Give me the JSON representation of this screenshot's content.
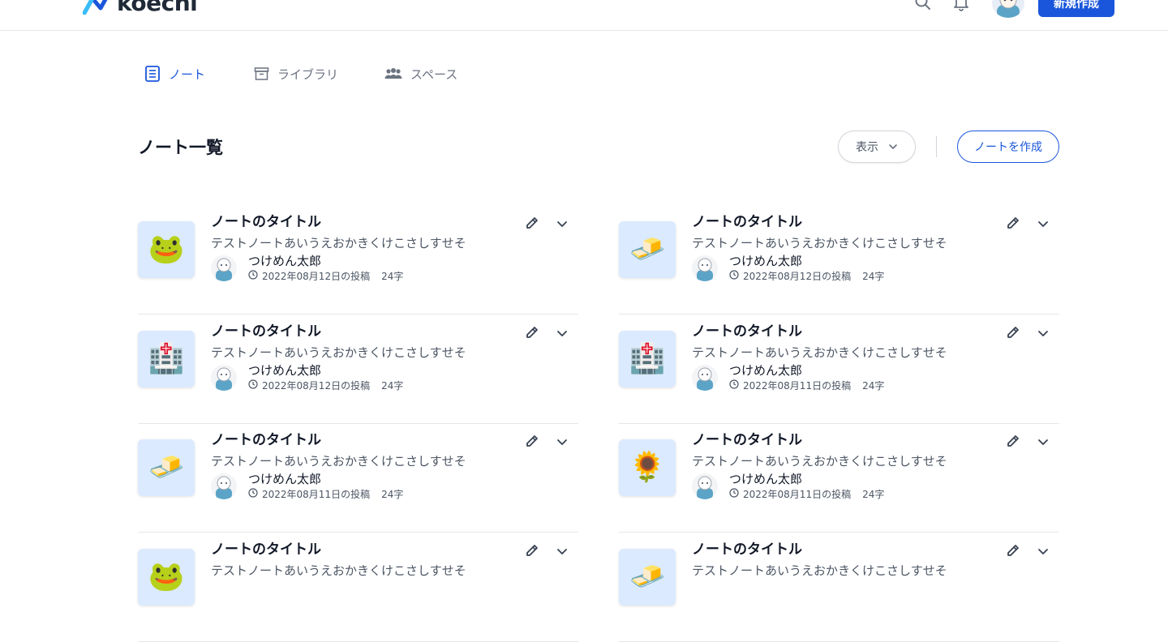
{
  "header": {
    "logo_text": "koechi",
    "new_button": "新規作成",
    "icons": [
      "search-icon",
      "bell-icon",
      "avatar"
    ]
  },
  "tabs": [
    {
      "label": "ノート",
      "icon": "note-icon",
      "active": true
    },
    {
      "label": "ライブラリ",
      "icon": "library-icon",
      "active": false
    },
    {
      "label": "スペース",
      "icon": "people-icon",
      "active": false
    }
  ],
  "main": {
    "title": "ノート一覧",
    "view_button": "表示",
    "create_button": "ノートを作成"
  },
  "notes": [
    {
      "emoji": "🐸",
      "title": "ノートのタイトル",
      "desc": "テストノートあいうえおかきくけこさしすせそ",
      "author": "つけめん太郎",
      "date": "2022年08月12日の投稿",
      "chars": "24字"
    },
    {
      "emoji": "🧈",
      "title": "ノートのタイトル",
      "desc": "テストノートあいうえおかきくけこさしすせそ",
      "author": "つけめん太郎",
      "date": "2022年08月12日の投稿",
      "chars": "24字"
    },
    {
      "emoji": "🏥",
      "title": "ノートのタイトル",
      "desc": "テストノートあいうえおかきくけこさしすせそ",
      "author": "つけめん太郎",
      "date": "2022年08月12日の投稿",
      "chars": "24字"
    },
    {
      "emoji": "🏥",
      "title": "ノートのタイトル",
      "desc": "テストノートあいうえおかきくけこさしすせそ",
      "author": "つけめん太郎",
      "date": "2022年08月11日の投稿",
      "chars": "24字"
    },
    {
      "emoji": "🧈",
      "title": "ノートのタイトル",
      "desc": "テストノートあいうえおかきくけこさしすせそ",
      "author": "つけめん太郎",
      "date": "2022年08月11日の投稿",
      "chars": "24字"
    },
    {
      "emoji": "🌻",
      "title": "ノートのタイトル",
      "desc": "テストノートあいうえおかきくけこさしすせそ",
      "author": "つけめん太郎",
      "date": "2022年08月11日の投稿",
      "chars": "24字"
    },
    {
      "emoji": "🐸",
      "title": "ノートのタイトル",
      "desc": "テストノートあいうえおかきくけこさしすせそ",
      "author": "",
      "date": "",
      "chars": ""
    },
    {
      "emoji": "🧈",
      "title": "ノートのタイトル",
      "desc": "テストノートあいうえおかきくけこさしすせそ",
      "author": "",
      "date": "",
      "chars": ""
    }
  ],
  "colors": {
    "accent": "#1a56db",
    "thumb_bg": "#dbeafe",
    "border": "#e5e7eb"
  }
}
